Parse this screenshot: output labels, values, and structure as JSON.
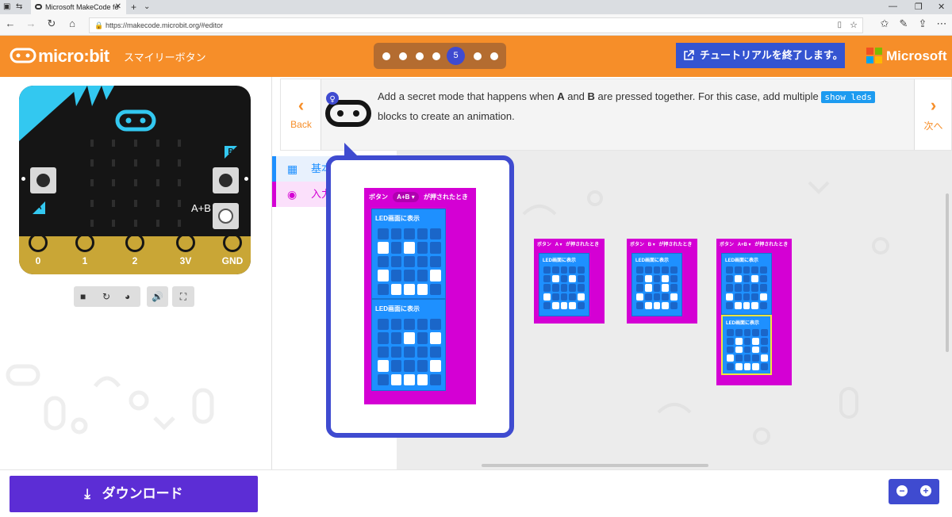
{
  "browser": {
    "tab_title": "Microsoft MakeCode fo",
    "url": "https://makecode.microbit.org/#editor"
  },
  "header": {
    "logo": "micro:bit",
    "project_name": "スマイリーボタン",
    "current_step": "5",
    "exit_label": "チュートリアルを終了します。",
    "brand": "Microsoft",
    "accent_color": "#f68e29"
  },
  "tutorial": {
    "back_label": "Back",
    "next_label": "次へ",
    "text_1": "Add a secret mode that happens when ",
    "key_a": "A",
    "text_2": " and ",
    "key_b": "B",
    "text_3": " are pressed together. For this case, add multiple ",
    "code": "show leds",
    "text_4": " blocks to create an animation."
  },
  "toolbox": {
    "items": [
      {
        "label": "基本",
        "color": "#1e90ff"
      },
      {
        "label": "入力",
        "color": "#d400d4"
      }
    ]
  },
  "simulator": {
    "pins": [
      "0",
      "1",
      "2",
      "3V",
      "GND"
    ],
    "button_a": "A",
    "button_b": "B",
    "button_ab": "A+B"
  },
  "blocks": {
    "event_prefix": "ボタン",
    "event_suffix": "が押されたとき",
    "show_leds": "LED画面に表示",
    "hint_button": "A+B",
    "ws_buttons": [
      "A",
      "B",
      "A+B"
    ]
  },
  "leds": {
    "hint_1": [
      0,
      0,
      0,
      0,
      0,
      1,
      0,
      1,
      0,
      0,
      0,
      0,
      0,
      0,
      0,
      1,
      0,
      0,
      0,
      1,
      0,
      1,
      1,
      1,
      0
    ],
    "hint_2": [
      0,
      0,
      0,
      0,
      0,
      0,
      0,
      1,
      0,
      1,
      0,
      0,
      0,
      0,
      0,
      1,
      0,
      0,
      0,
      1,
      0,
      1,
      1,
      1,
      0
    ],
    "ws_a": [
      0,
      0,
      0,
      0,
      0,
      0,
      1,
      0,
      1,
      0,
      0,
      0,
      0,
      0,
      0,
      1,
      0,
      0,
      0,
      1,
      0,
      1,
      1,
      1,
      0
    ],
    "ws_b": [
      0,
      0,
      0,
      0,
      0,
      0,
      1,
      0,
      1,
      0,
      0,
      1,
      0,
      1,
      0,
      1,
      0,
      0,
      0,
      1,
      0,
      1,
      1,
      1,
      0
    ],
    "ws_ab_1": [
      0,
      0,
      0,
      0,
      0,
      0,
      1,
      0,
      1,
      0,
      0,
      0,
      0,
      0,
      0,
      1,
      0,
      0,
      0,
      1,
      0,
      1,
      1,
      1,
      0
    ],
    "ws_ab_2": [
      0,
      0,
      0,
      0,
      0,
      0,
      1,
      0,
      1,
      0,
      0,
      1,
      0,
      1,
      0,
      1,
      0,
      0,
      0,
      1,
      0,
      1,
      1,
      1,
      0
    ]
  },
  "footer": {
    "download_label": "ダウンロード",
    "zoom_out": "−",
    "zoom_in": "+"
  }
}
